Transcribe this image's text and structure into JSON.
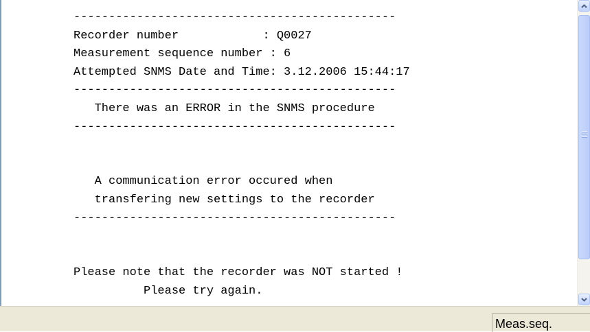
{
  "report": {
    "text": "----------------------------------------------\nRecorder number            : Q0027\nMeasurement sequence number : 6\nAttempted SNMS Date and Time: 3.12.2006 15:44:17\n----------------------------------------------\n   There was an ERROR in the SNMS procedure\n----------------------------------------------\n\n\n   A communication error occured when\n   transfering new settings to the recorder\n----------------------------------------------\n\n\nPlease note that the recorder was NOT started !\n          Please try again."
  },
  "status_bar": {
    "panel_text": "Meas.seq."
  },
  "icons": {
    "scroll_up": "chevron-up-icon",
    "scroll_down": "chevron-down-icon"
  },
  "colors": {
    "status_bar_bg": "#ece9d8",
    "scroll_accent": "#4d6185"
  }
}
